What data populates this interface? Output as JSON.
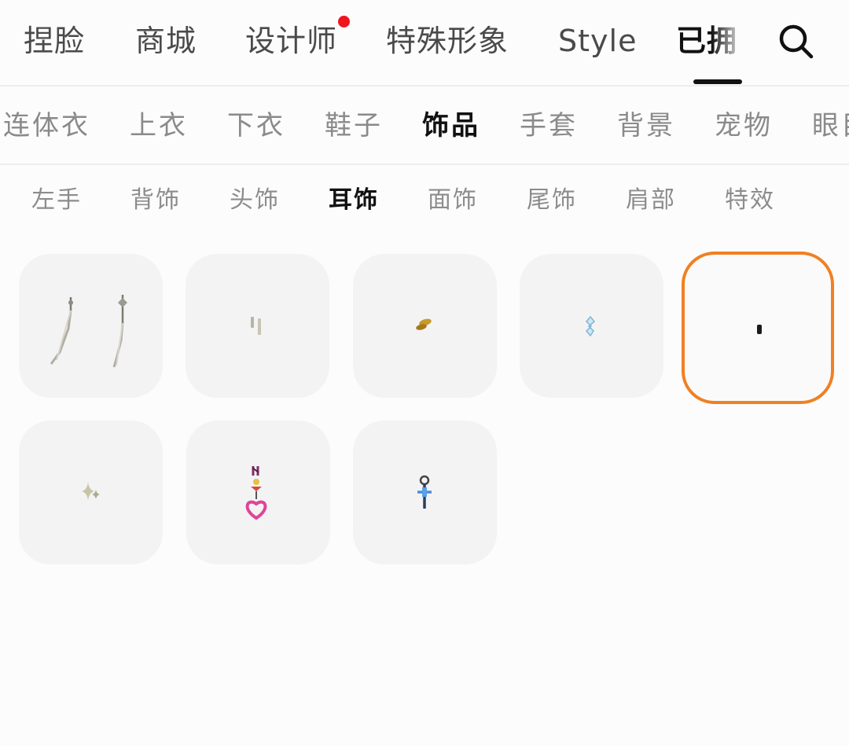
{
  "top_tabs": [
    {
      "label": "捏脸"
    },
    {
      "label": "商城"
    },
    {
      "label": "设计师",
      "has_notification_dot": true
    },
    {
      "label": "特殊形象"
    },
    {
      "label": "Style"
    },
    {
      "label": "已拥有",
      "visible_label": "已拥",
      "active": true
    }
  ],
  "category_tabs": [
    {
      "label": "连体衣"
    },
    {
      "label": "上衣"
    },
    {
      "label": "下衣"
    },
    {
      "label": "鞋子"
    },
    {
      "label": "饰品",
      "active": true
    },
    {
      "label": "手套"
    },
    {
      "label": "背景"
    },
    {
      "label": "宠物"
    },
    {
      "label": "眼睛",
      "visible_label": "眼目"
    }
  ],
  "sub_tabs": [
    {
      "label": "左手"
    },
    {
      "label": "背饰"
    },
    {
      "label": "头饰"
    },
    {
      "label": "耳饰",
      "active": true
    },
    {
      "label": "面饰"
    },
    {
      "label": "尾饰"
    },
    {
      "label": "肩部"
    },
    {
      "label": "特效"
    }
  ],
  "items": [
    {
      "icon": "silver-tassel-earrings-icon"
    },
    {
      "icon": "silver-bar-studs-icon"
    },
    {
      "icon": "gold-link-earring-icon"
    },
    {
      "icon": "crystal-drop-earring-icon"
    },
    {
      "icon": "black-stud-earring-icon",
      "selected": true
    },
    {
      "icon": "sparkle-star-earring-icon"
    },
    {
      "icon": "pink-heart-earring-icon"
    },
    {
      "icon": "blue-cross-earring-icon"
    }
  ],
  "colors": {
    "accent_selected": "#f08023",
    "notification": "#f0141e",
    "active_text": "#111111"
  }
}
